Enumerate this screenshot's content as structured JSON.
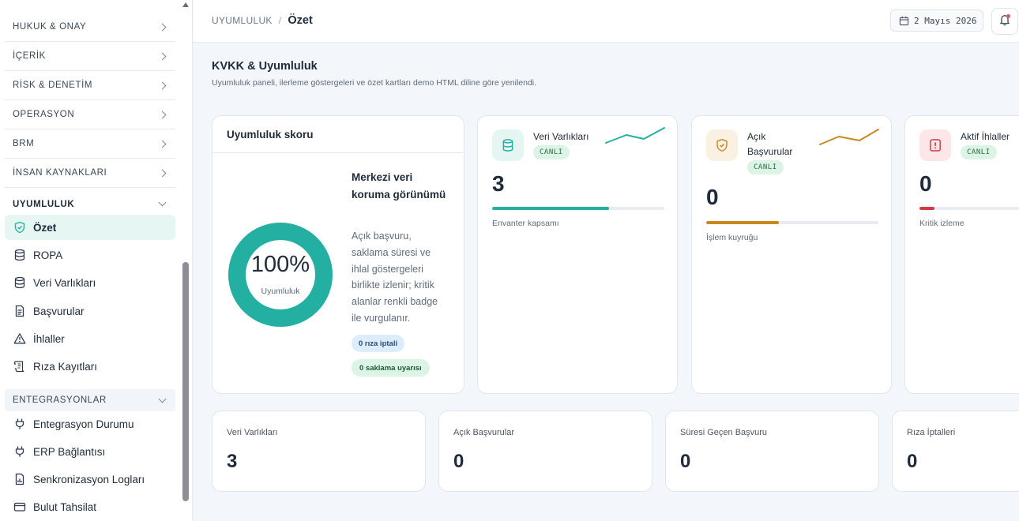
{
  "sidebar": {
    "sections": [
      {
        "label": "HUKUK & ONAY"
      },
      {
        "label": "İÇERİK"
      },
      {
        "label": "RİSK & DENETİM"
      },
      {
        "label": "OPERASYON"
      },
      {
        "label": "BRM"
      },
      {
        "label": "İNSAN KAYNAKLARI"
      },
      {
        "label": "UYUMLULUK"
      },
      {
        "label": "ENTEGRASYONLAR"
      }
    ],
    "uyumluluk_items": [
      {
        "label": "Özet",
        "icon": "shield-check-icon"
      },
      {
        "label": "ROPA",
        "icon": "database-icon"
      },
      {
        "label": "Veri Varlıkları",
        "icon": "database-icon"
      },
      {
        "label": "Başvurular",
        "icon": "document-icon"
      },
      {
        "label": "İhlaller",
        "icon": "warning-icon"
      },
      {
        "label": "Rıza Kayıtları",
        "icon": "scroll-icon"
      }
    ],
    "integration_items": [
      {
        "label": "Entegrasyon Durumu",
        "icon": "plug-icon"
      },
      {
        "label": "ERP Bağlantısı",
        "icon": "plug-icon"
      },
      {
        "label": "Senkronizasyon Logları",
        "icon": "log-icon"
      },
      {
        "label": "Bulut Tahsilat",
        "icon": "card-icon"
      }
    ]
  },
  "header": {
    "breadcrumb_parent": "UYUMLULUK",
    "breadcrumb_sep": "/",
    "breadcrumb_current": "Özet",
    "date": "2 Mayıs 2026"
  },
  "page": {
    "title": "KVKK & Uyumluluk",
    "subtitle": "Uyumluluk paneli, ilerleme göstergeleri ve özet kartları demo HTML diline göre yenilendi."
  },
  "score": {
    "title": "Uyumluluk skoru",
    "value": "100%",
    "percent": 100,
    "caption": "Uyumluluk",
    "heading": "Merkezi veri koruma görünümü",
    "description": "Açık başvuru, saklama süresi ve ihlal göstergeleri birlikte izlenir; kritik alanlar renkli badge ile vurgulanır.",
    "badge_consent": "0 rıza iptali",
    "badge_retention": "0 saklama uyarısı"
  },
  "kpis": [
    {
      "label": "Veri Varlıkları",
      "status": "CANLI",
      "value": "3",
      "foot": "Envanter kapsamı",
      "progress": 0.68,
      "color": "#23b0a2",
      "icon": "database-icon"
    },
    {
      "label": "Açık Başvurular",
      "status": "CANLI",
      "value": "0",
      "foot": "İşlem kuyruğu",
      "progress": 0.42,
      "color": "#c88a1e",
      "icon": "shield-icon"
    },
    {
      "label": "Aktif İhlaller",
      "status": "CANLI",
      "value": "0",
      "foot": "Kritik izleme",
      "progress": 0.15,
      "color": "#d43a46",
      "icon": "alert-icon"
    }
  ],
  "stats": [
    {
      "label": "Veri Varlıkları",
      "value": "3"
    },
    {
      "label": "Açık Başvurular",
      "value": "0"
    },
    {
      "label": "Süresi Geçen Başvuru",
      "value": "0"
    },
    {
      "label": "Rıza İptalleri",
      "value": "0"
    }
  ],
  "colors": {
    "accent": "#23b0a2",
    "warning": "#c88a1e",
    "danger": "#d43a46"
  }
}
